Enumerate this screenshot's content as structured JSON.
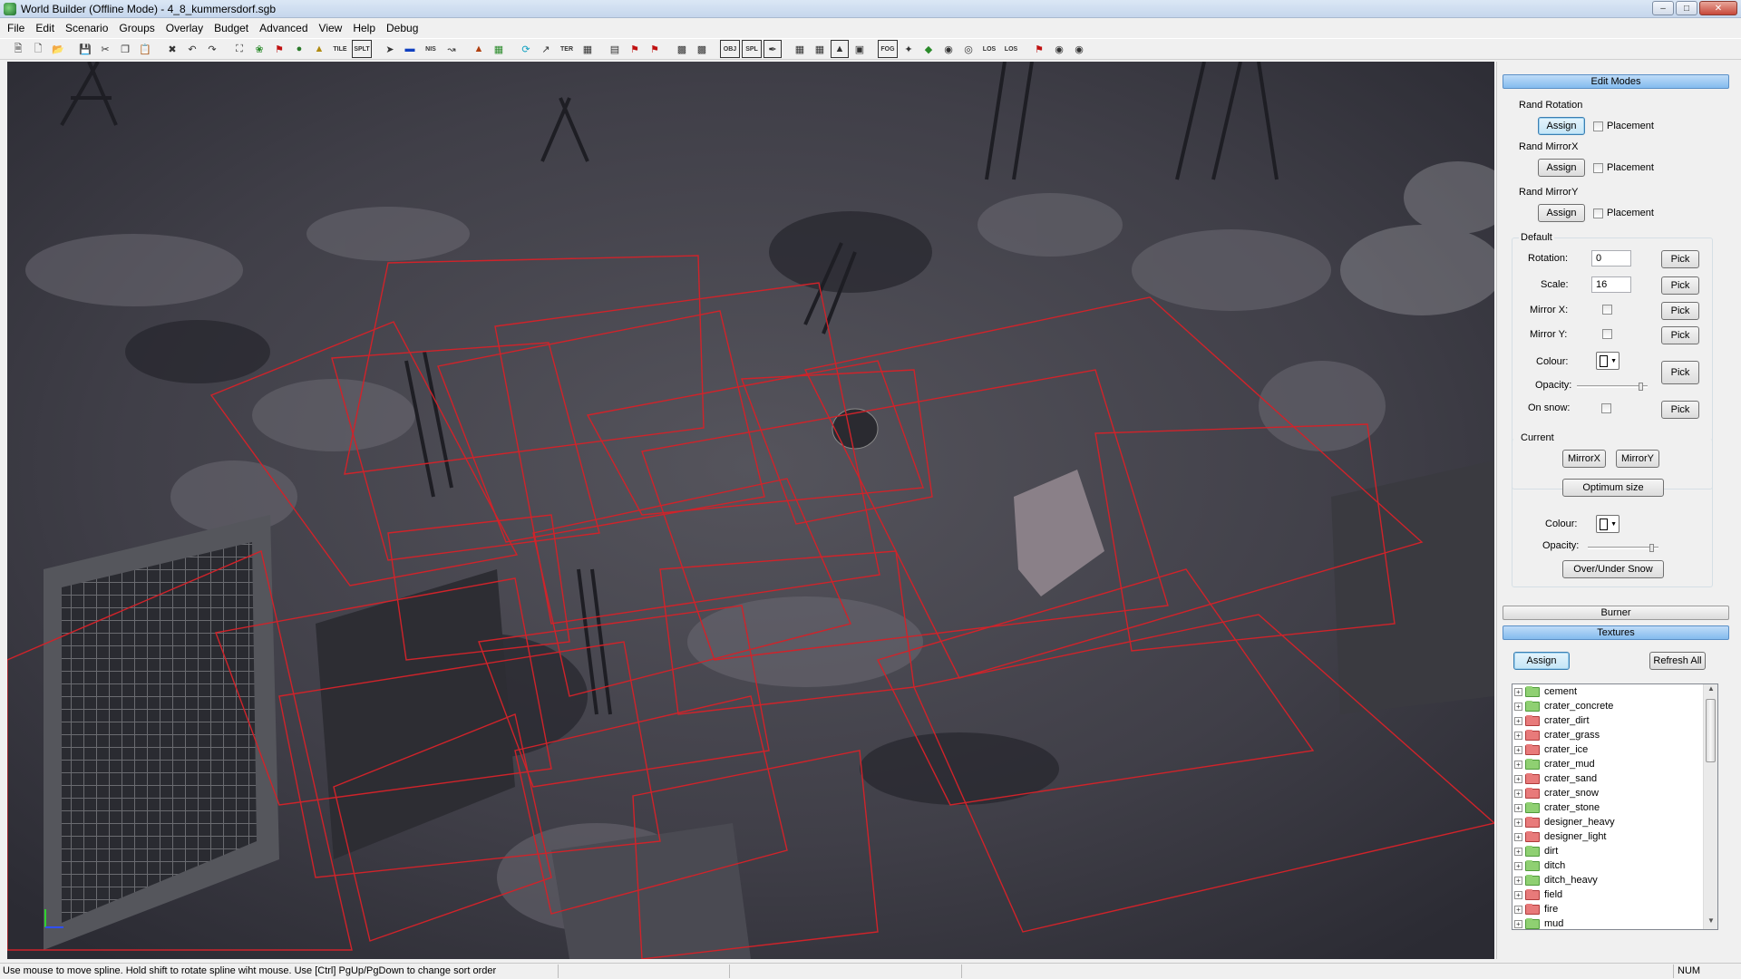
{
  "window": {
    "title": "World Builder (Offline Mode) - 4_8_kummersdorf.sgb"
  },
  "menu": [
    "File",
    "Edit",
    "Scenario",
    "Groups",
    "Overlay",
    "Budget",
    "Advanced",
    "View",
    "Help",
    "Debug"
  ],
  "toolbar": {
    "text_buttons": [
      "TILE",
      "SPLT",
      "NIS",
      "TER",
      "OBJ",
      "SPL",
      "FOG",
      "LOS",
      "LOS"
    ]
  },
  "panel": {
    "edit_modes_header": "Edit Modes",
    "rand_rotation": {
      "label": "Rand Rotation",
      "assign": "Assign",
      "placement": "Placement"
    },
    "rand_mirrorx": {
      "label": "Rand MirrorX",
      "assign": "Assign",
      "placement": "Placement"
    },
    "rand_mirrory": {
      "label": "Rand MirrorY",
      "assign": "Assign",
      "placement": "Placement"
    },
    "default": {
      "label": "Default",
      "rotation_label": "Rotation:",
      "rotation_value": "0",
      "scale_label": "Scale:",
      "scale_value": "16",
      "mirror_x_label": "Mirror X:",
      "mirror_y_label": "Mirror Y:",
      "colour_label": "Colour:",
      "opacity_label": "Opacity:",
      "on_snow_label": "On snow:",
      "pick": "Pick",
      "opacity_level": 0.95
    },
    "current": {
      "label": "Current",
      "mirrorx": "MirrorX",
      "mirrory": "MirrorY",
      "optimum_size": "Optimum size",
      "colour_label": "Colour:",
      "opacity_label": "Opacity:",
      "over_under_snow": "Over/Under Snow",
      "opacity_level": 0.95
    },
    "burner_header": "Burner",
    "textures_header": "Textures",
    "assign": "Assign",
    "refresh_all": "Refresh All",
    "textures": [
      {
        "name": "cement",
        "color": "green"
      },
      {
        "name": "crater_concrete",
        "color": "green"
      },
      {
        "name": "crater_dirt",
        "color": "red"
      },
      {
        "name": "crater_grass",
        "color": "red"
      },
      {
        "name": "crater_ice",
        "color": "red"
      },
      {
        "name": "crater_mud",
        "color": "green"
      },
      {
        "name": "crater_sand",
        "color": "red"
      },
      {
        "name": "crater_snow",
        "color": "red"
      },
      {
        "name": "crater_stone",
        "color": "green"
      },
      {
        "name": "designer_heavy",
        "color": "red"
      },
      {
        "name": "designer_light",
        "color": "red"
      },
      {
        "name": "dirt",
        "color": "green"
      },
      {
        "name": "ditch",
        "color": "green"
      },
      {
        "name": "ditch_heavy",
        "color": "green"
      },
      {
        "name": "field",
        "color": "red"
      },
      {
        "name": "fire",
        "color": "red"
      },
      {
        "name": "mud",
        "color": "green"
      }
    ]
  },
  "status": {
    "message": "Use mouse to move spline. Hold shift to rotate spline wiht mouse. Use [Ctrl] PgUp/PgDown to change sort order",
    "num": "NUM"
  },
  "colors": {
    "spline": "#d0232a",
    "header_blue": "#84bbee"
  }
}
